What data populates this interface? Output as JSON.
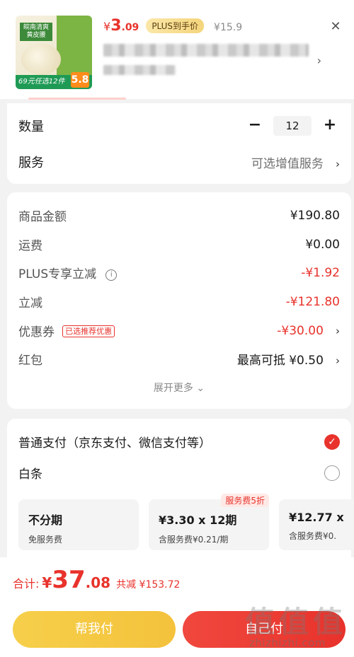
{
  "product": {
    "price_symbol": "¥",
    "price_int": "3",
    "price_dec": ".09",
    "plus_badge": "PLUS到手价",
    "original_price": "¥15.9",
    "image": {
      "bag_text": "皖南清爽 黄皮腰",
      "brand_mark": "百草味",
      "promo_text": "69元任选12件",
      "promo_num": "5.8"
    }
  },
  "quantity": {
    "label": "数量",
    "value": "12",
    "minus": "−",
    "plus": "+"
  },
  "service": {
    "label": "服务",
    "value": "可选增值服务"
  },
  "price_details": {
    "goods_amount": {
      "label": "商品金额",
      "value": "¥190.80"
    },
    "shipping": {
      "label": "运费",
      "value": "¥0.00"
    },
    "plus_discount": {
      "label": "PLUS专享立减",
      "value": "-¥1.92"
    },
    "instant_discount": {
      "label": "立减",
      "value": "-¥121.80"
    },
    "coupon": {
      "label": "优惠券",
      "tag": "已选推荐优惠",
      "value": "-¥30.00"
    },
    "red_packet": {
      "label": "红包",
      "value": "最高可抵 ¥0.50"
    },
    "expand": "展开更多"
  },
  "payment": {
    "normal": {
      "label": "普通支付（京东支付、微信支付等）",
      "selected": true
    },
    "baitiao": {
      "label": "白条",
      "selected": false
    },
    "plans": [
      {
        "title": "不分期",
        "subtitle": "免服务费",
        "tag": ""
      },
      {
        "title": "¥3.30 x 12期",
        "subtitle": "含服务费¥0.21/期",
        "tag": "服务费5折"
      },
      {
        "title": "¥12.77 x",
        "subtitle": "含服务费¥0.",
        "tag": ""
      }
    ]
  },
  "footer": {
    "total_label": "合计:",
    "total_yen": "¥",
    "total_int": "37",
    "total_dec": ".08",
    "total_saved": "共减 ¥153.72",
    "help_pay": "帮我付",
    "self_pay": "自己付"
  },
  "watermark": {
    "chars": [
      "值",
      "值",
      "值"
    ],
    "url": "zhizhizhi.com"
  },
  "colors": {
    "accent_red": "#e8322b",
    "help_yellow": "#f4c23c"
  }
}
